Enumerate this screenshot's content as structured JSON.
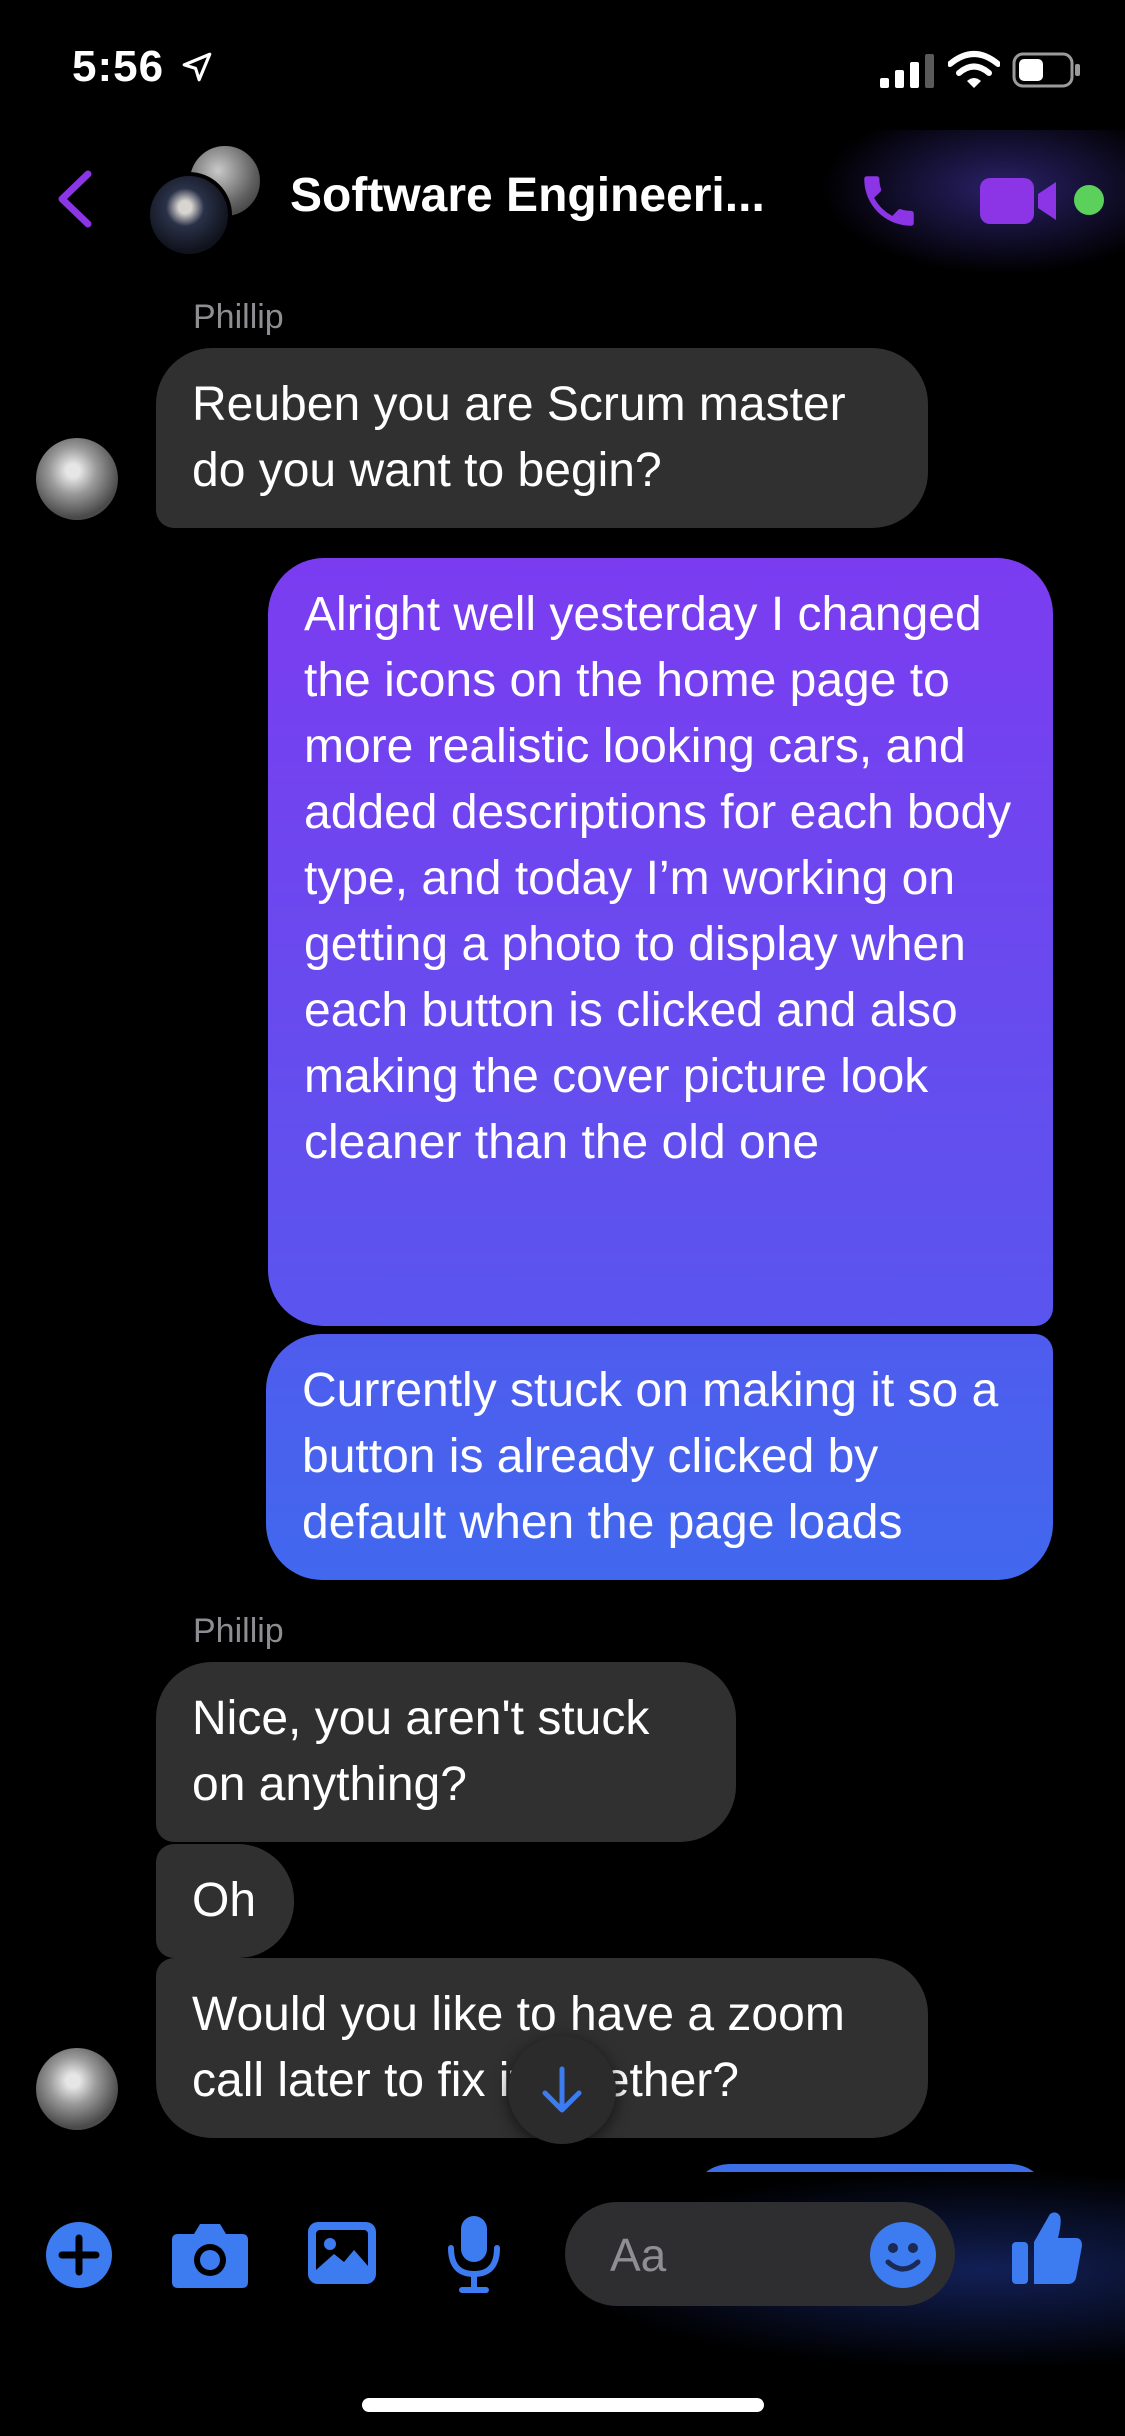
{
  "status_bar": {
    "time": "5:56"
  },
  "header": {
    "title": "Software Engineeri..."
  },
  "messages": [
    {
      "sender": "Phillip",
      "direction": "incoming",
      "text": "Reuben you are Scrum master do you want to begin?"
    },
    {
      "direction": "outgoing",
      "text": "Alright well yesterday I changed the icons on the home page to more realistic looking cars, and added descriptions for each body type, and today I’m working on getting a photo to display when each button is clicked and also making the cover picture look cleaner than the old one"
    },
    {
      "direction": "outgoing",
      "text": "Currently stuck on making it so a button is already clicked by default when the page loads"
    },
    {
      "sender": "Phillip",
      "direction": "incoming",
      "text": "Nice, you aren't stuck on anything?"
    },
    {
      "direction": "incoming",
      "text": "Oh"
    },
    {
      "direction": "incoming",
      "text": "Would you like to have a zoom call later to fix it together?"
    }
  ],
  "composer": {
    "placeholder": "Aa"
  },
  "colors": {
    "accent_purple": "#8b35e6",
    "accent_blue": "#3d7bf0",
    "incoming_bubble": "#303030",
    "outgoing_gradient_top": "#7b3cf0",
    "outgoing_gradient_bottom": "#4168ee",
    "online": "#5bd15b"
  },
  "icons": [
    "location-arrow-icon",
    "signal-icon",
    "wifi-icon",
    "battery-icon",
    "back-icon",
    "phone-icon",
    "video-icon",
    "plus-icon",
    "camera-icon",
    "gallery-icon",
    "microphone-icon",
    "emoji-icon",
    "thumbs-up-icon",
    "arrow-down-icon"
  ]
}
